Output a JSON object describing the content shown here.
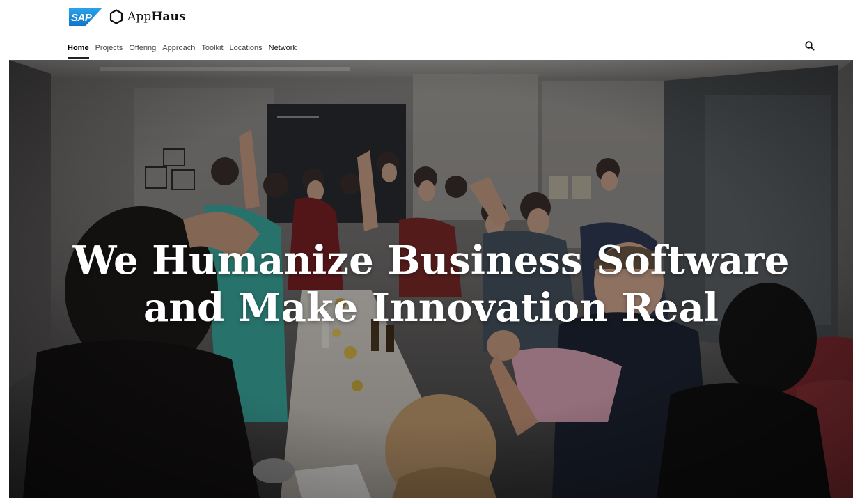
{
  "brand": {
    "sap_logo_text": "SAP",
    "apphaus_prefix": "App",
    "apphaus_suffix": "Haus",
    "logo_icon": "hexagon-icon"
  },
  "nav": {
    "items": [
      {
        "label": "Home",
        "active": true
      },
      {
        "label": "Projects",
        "active": false
      },
      {
        "label": "Offering",
        "active": false
      },
      {
        "label": "Approach",
        "active": false
      },
      {
        "label": "Toolkit",
        "active": false
      },
      {
        "label": "Locations",
        "active": false
      },
      {
        "label": "Network",
        "active": false
      }
    ],
    "search_icon": "search-icon"
  },
  "hero": {
    "title_line1": "We Humanize Business Software",
    "title_line2": "and Make Innovation Real",
    "background": "photo of a group of people cheering around a long table"
  },
  "colors": {
    "sap_blue": "#1a8ad6",
    "header_bg": "#ffffff",
    "text_dark": "#111111",
    "hero_text": "#ffffff"
  }
}
